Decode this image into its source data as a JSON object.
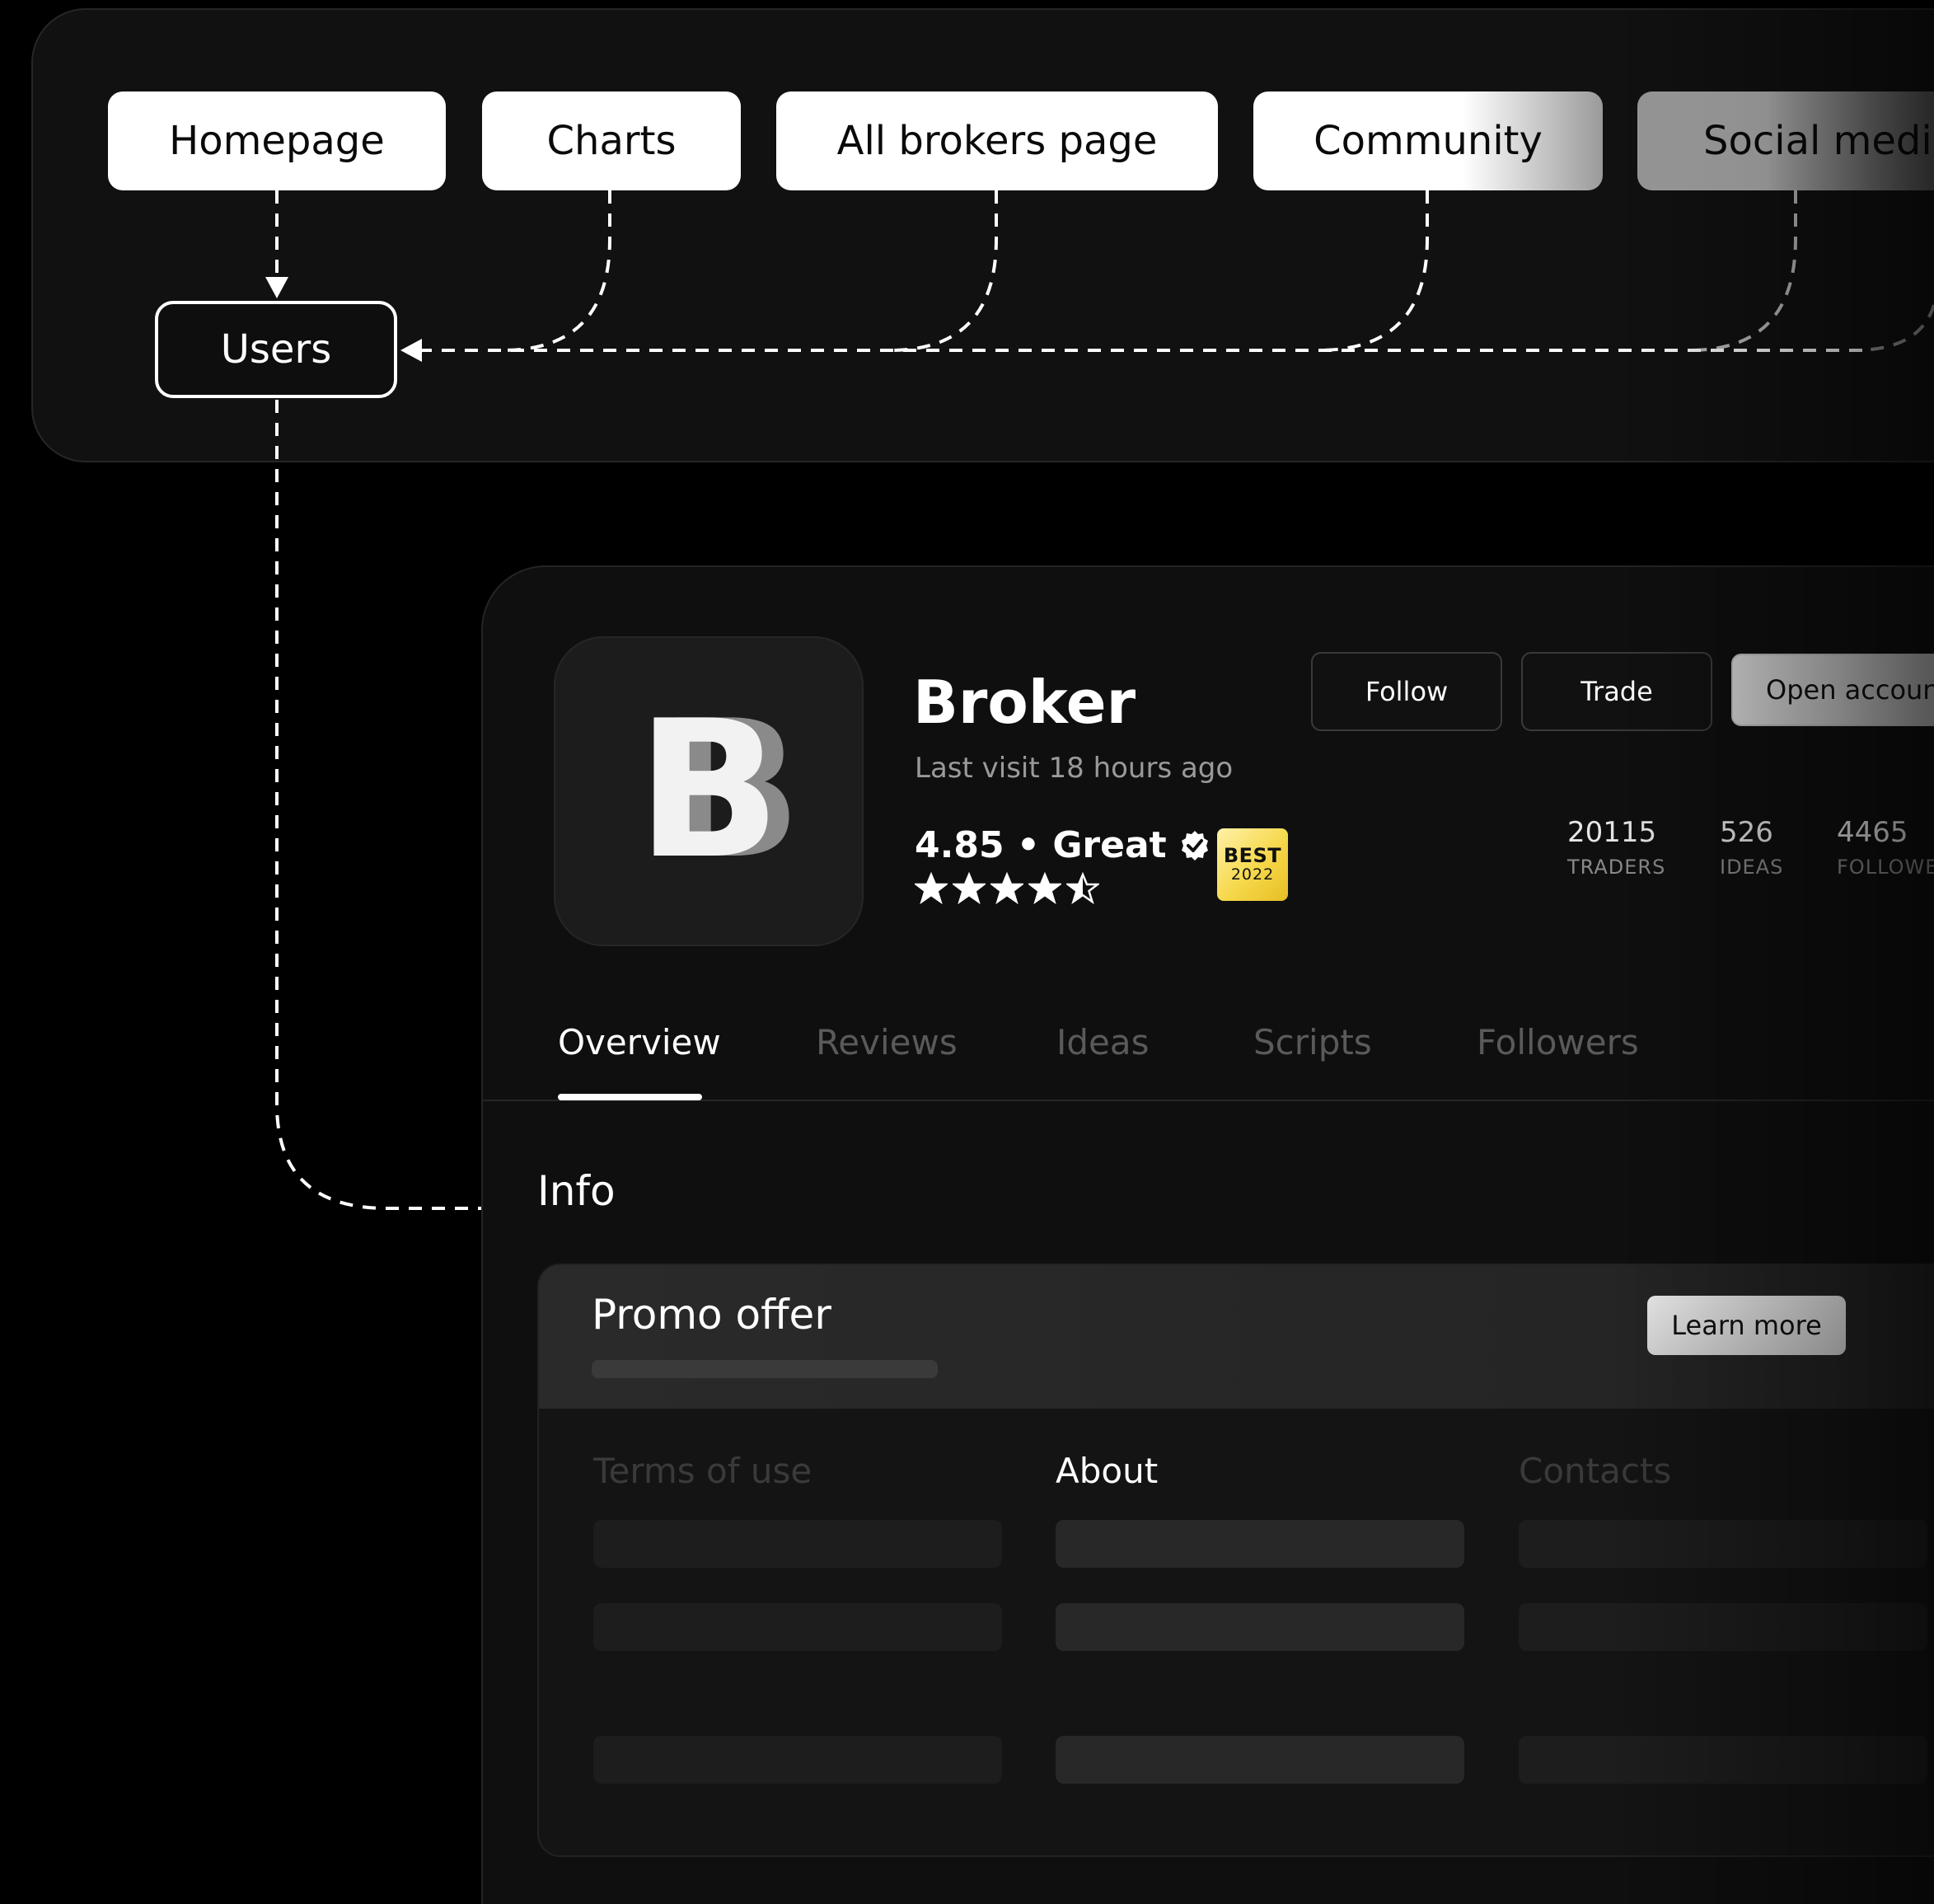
{
  "diagram": {
    "sources": [
      {
        "label": "Homepage"
      },
      {
        "label": "Charts"
      },
      {
        "label": "All brokers page"
      },
      {
        "label": "Community"
      },
      {
        "label": "Social media"
      }
    ],
    "target": {
      "label": "Users"
    }
  },
  "profile": {
    "logo_letter": "B",
    "name": "Broker",
    "last_visit": "Last visit 18 hours ago",
    "rating_text": "4.85 • Great",
    "rating_value": 4.5,
    "badge": {
      "line1": "BEST",
      "line2": "2022"
    },
    "actions": {
      "follow": "Follow",
      "trade": "Trade",
      "open_account": "Open account"
    },
    "stats": [
      {
        "value": "20115",
        "label": "TRADERS"
      },
      {
        "value": "526",
        "label": "IDEAS"
      },
      {
        "value": "4465",
        "label": "FOLLOWERS"
      }
    ],
    "tabs": [
      "Overview",
      "Reviews",
      "Ideas",
      "Scripts",
      "Followers"
    ],
    "active_tab": "Overview",
    "info_title": "Info",
    "promo": {
      "title": "Promo offer",
      "button": "Learn more"
    },
    "columns": [
      "Terms of use",
      "About",
      "Contacts"
    ]
  },
  "colors": {
    "background": "#000000",
    "panel": "#111111",
    "pill": "#ffffff",
    "badge": "#f6d84a",
    "muted_text": "#9a9a9a"
  }
}
